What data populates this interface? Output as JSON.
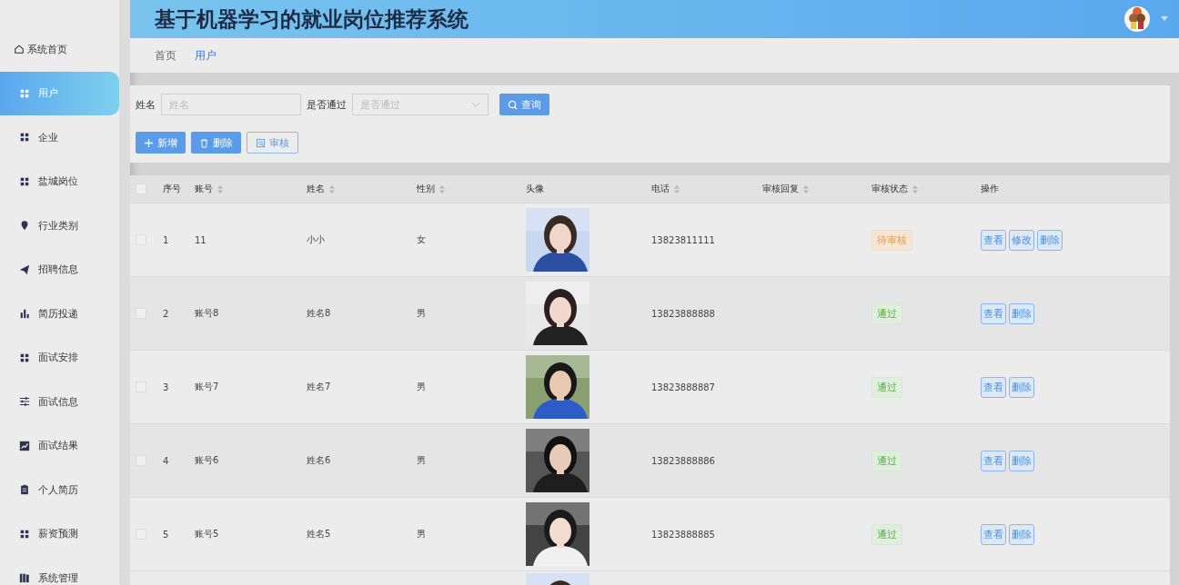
{
  "header": {
    "title": "基于机器学习的就业岗位推荐系统"
  },
  "sidebar": {
    "items": [
      {
        "label": "系统首页",
        "kind": "home",
        "selected": false
      },
      {
        "label": "用户",
        "kind": "grid",
        "selected": true
      },
      {
        "label": "企业",
        "kind": "grid",
        "selected": false
      },
      {
        "label": "盐城岗位",
        "kind": "grid",
        "selected": false
      },
      {
        "label": "行业类别",
        "kind": "pin",
        "selected": false
      },
      {
        "label": "招聘信息",
        "kind": "plane",
        "selected": false
      },
      {
        "label": "简历投递",
        "kind": "bars",
        "selected": false
      },
      {
        "label": "面试安排",
        "kind": "grid",
        "selected": false
      },
      {
        "label": "面试信息",
        "kind": "sliders",
        "selected": false
      },
      {
        "label": "面试结果",
        "kind": "chart",
        "selected": false
      },
      {
        "label": "个人简历",
        "kind": "clipboard",
        "selected": false
      },
      {
        "label": "薪资预测",
        "kind": "grid",
        "selected": false
      },
      {
        "label": "系统管理",
        "kind": "books",
        "selected": false
      }
    ]
  },
  "breadcrumb": [
    {
      "label": "首页",
      "selected": false
    },
    {
      "label": "用户",
      "selected": true
    }
  ],
  "search": {
    "name_label": "姓名",
    "name_placeholder": "姓名",
    "pass_label": "是否通过",
    "pass_placeholder": "是否通过",
    "query_button": "查询"
  },
  "actions": [
    {
      "label": "新增",
      "kind": "add"
    },
    {
      "label": "删除",
      "kind": "delete"
    },
    {
      "label": "审核",
      "kind": "review"
    }
  ],
  "table": {
    "all_checked": false,
    "columns": [
      {
        "label": "序号",
        "sortable": false
      },
      {
        "label": "账号",
        "sortable": true
      },
      {
        "label": "姓名",
        "sortable": true
      },
      {
        "label": "性别",
        "sortable": true
      },
      {
        "label": "头像",
        "sortable": false
      },
      {
        "label": "电话",
        "sortable": true
      },
      {
        "label": "审核回复",
        "sortable": true
      },
      {
        "label": "审核状态",
        "sortable": true
      },
      {
        "label": "操作",
        "sortable": false
      }
    ],
    "rows": [
      {
        "checked": false,
        "index": "1",
        "account": "11",
        "name": "小小",
        "gender": "女",
        "phone": "13823811111",
        "status": {
          "label": "待审核",
          "kind": "pending"
        },
        "buttons": [
          "查看",
          "修改",
          "删除"
        ]
      },
      {
        "checked": false,
        "index": "2",
        "account": "账号8",
        "name": "姓名8",
        "gender": "男",
        "phone": "13823888888",
        "status": {
          "label": "通过",
          "kind": "passed"
        },
        "buttons": [
          "查看",
          "删除"
        ]
      },
      {
        "checked": false,
        "index": "3",
        "account": "账号7",
        "name": "姓名7",
        "gender": "男",
        "phone": "13823888887",
        "status": {
          "label": "通过",
          "kind": "passed"
        },
        "buttons": [
          "查看",
          "删除"
        ]
      },
      {
        "checked": false,
        "index": "4",
        "account": "账号6",
        "name": "姓名6",
        "gender": "男",
        "phone": "13823888886",
        "status": {
          "label": "通过",
          "kind": "passed"
        },
        "buttons": [
          "查看",
          "删除"
        ]
      },
      {
        "checked": false,
        "index": "5",
        "account": "账号5",
        "name": "姓名5",
        "gender": "男",
        "phone": "13823888885",
        "status": {
          "label": "通过",
          "kind": "passed"
        },
        "buttons": [
          "查看",
          "删除"
        ]
      }
    ]
  }
}
